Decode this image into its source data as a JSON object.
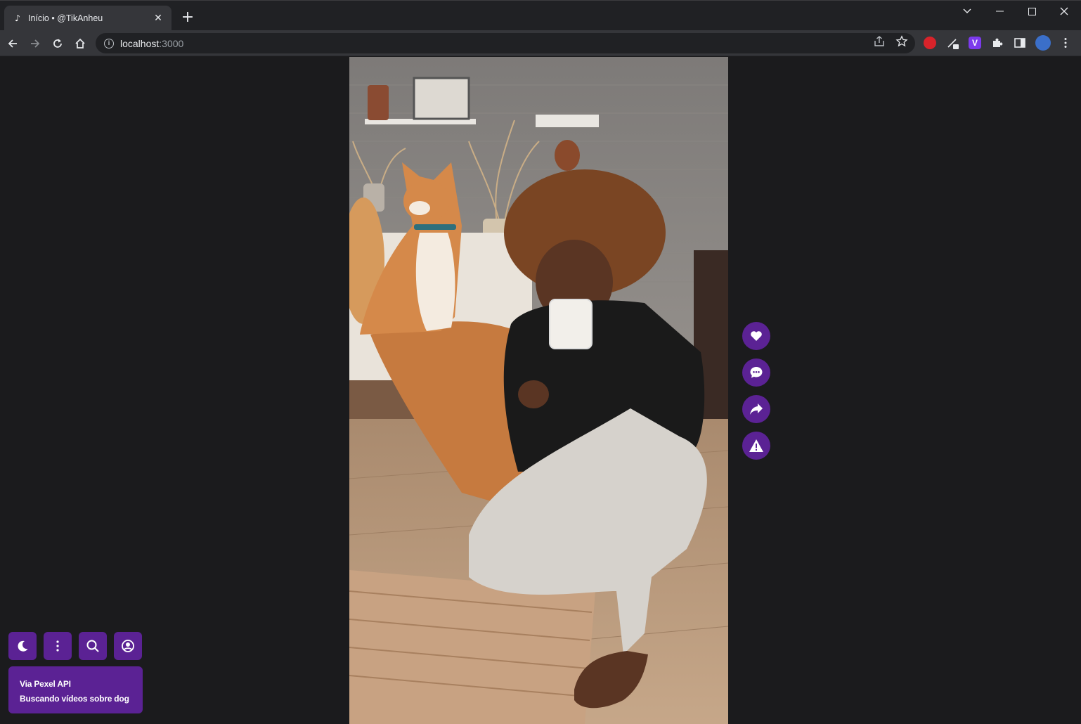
{
  "browser": {
    "tab_title": "Início • @TikAnheu",
    "tab_favicon": "tiktok-icon",
    "url_host": "localhost",
    "url_port": ":3000"
  },
  "video": {
    "description": "woman drinking coffee on floor with shiba inu dog",
    "colors": {
      "wall": "#8e8a86",
      "floor": "#b08c6c",
      "blanket": "#c67a3f",
      "sweater": "#1a1a1a",
      "pants": "#d6d2cc",
      "dog": "#d5894a"
    }
  },
  "actions": [
    {
      "name": "like",
      "icon": "heart-icon"
    },
    {
      "name": "comment",
      "icon": "comment-icon"
    },
    {
      "name": "share",
      "icon": "share-icon"
    },
    {
      "name": "report",
      "icon": "warning-icon"
    }
  ],
  "toolbar_buttons": [
    {
      "name": "theme",
      "icon": "moon-icon"
    },
    {
      "name": "menu",
      "icon": "more-vertical-icon"
    },
    {
      "name": "search",
      "icon": "search-icon"
    },
    {
      "name": "profile",
      "icon": "user-circle-icon"
    }
  ],
  "info": {
    "source": "Via Pexel API",
    "query": "Buscando vídeos sobre dog"
  },
  "colors": {
    "accent": "#5b2294",
    "background": "#1b1b1d"
  }
}
